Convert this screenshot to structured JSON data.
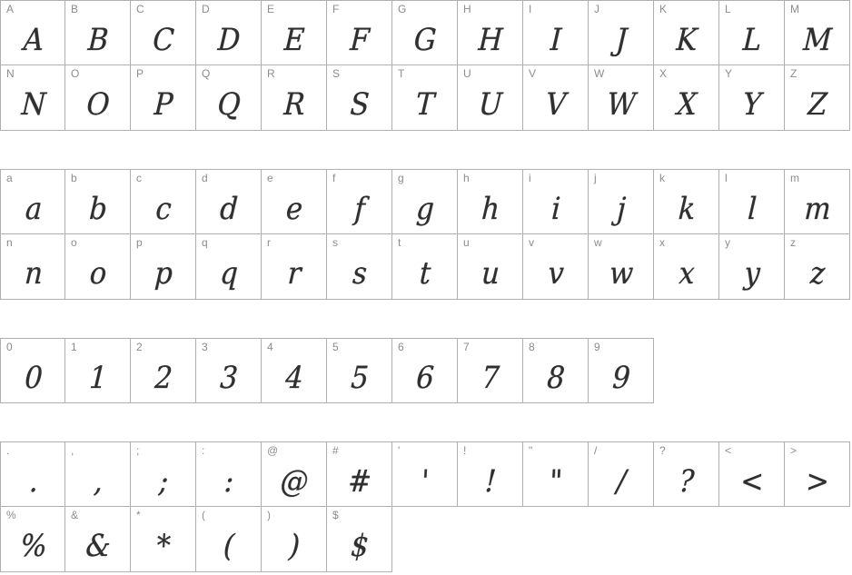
{
  "sheet": {
    "title": "Font specimen sheet",
    "colors": {
      "background": "#ffffff",
      "cell_border": "#b0b0b0",
      "label_text": "#8c8c8c",
      "glyph_text": "#2f2f2f"
    }
  },
  "sections": [
    {
      "id": "uppercase",
      "name": "uppercase-letters",
      "columns": 13,
      "rows": [
        [
          {
            "label": "A",
            "glyph": "A"
          },
          {
            "label": "B",
            "glyph": "B"
          },
          {
            "label": "C",
            "glyph": "C"
          },
          {
            "label": "D",
            "glyph": "D"
          },
          {
            "label": "E",
            "glyph": "E"
          },
          {
            "label": "F",
            "glyph": "F"
          },
          {
            "label": "G",
            "glyph": "G"
          },
          {
            "label": "H",
            "glyph": "H"
          },
          {
            "label": "I",
            "glyph": "I"
          },
          {
            "label": "J",
            "glyph": "J"
          },
          {
            "label": "K",
            "glyph": "K"
          },
          {
            "label": "L",
            "glyph": "L"
          },
          {
            "label": "M",
            "glyph": "M"
          }
        ],
        [
          {
            "label": "N",
            "glyph": "N"
          },
          {
            "label": "O",
            "glyph": "O"
          },
          {
            "label": "P",
            "glyph": "P"
          },
          {
            "label": "Q",
            "glyph": "Q"
          },
          {
            "label": "R",
            "glyph": "R"
          },
          {
            "label": "S",
            "glyph": "S"
          },
          {
            "label": "T",
            "glyph": "T"
          },
          {
            "label": "U",
            "glyph": "U"
          },
          {
            "label": "V",
            "glyph": "V"
          },
          {
            "label": "W",
            "glyph": "W"
          },
          {
            "label": "X",
            "glyph": "X"
          },
          {
            "label": "Y",
            "glyph": "Y"
          },
          {
            "label": "Z",
            "glyph": "Z"
          }
        ]
      ]
    },
    {
      "id": "lowercase",
      "name": "lowercase-letters",
      "columns": 13,
      "rows": [
        [
          {
            "label": "a",
            "glyph": "a"
          },
          {
            "label": "b",
            "glyph": "b"
          },
          {
            "label": "c",
            "glyph": "c"
          },
          {
            "label": "d",
            "glyph": "d"
          },
          {
            "label": "e",
            "glyph": "e"
          },
          {
            "label": "f",
            "glyph": "f"
          },
          {
            "label": "g",
            "glyph": "g"
          },
          {
            "label": "h",
            "glyph": "h"
          },
          {
            "label": "i",
            "glyph": "i"
          },
          {
            "label": "j",
            "glyph": "j"
          },
          {
            "label": "k",
            "glyph": "k"
          },
          {
            "label": "l",
            "glyph": "l"
          },
          {
            "label": "m",
            "glyph": "m"
          }
        ],
        [
          {
            "label": "n",
            "glyph": "n"
          },
          {
            "label": "o",
            "glyph": "o"
          },
          {
            "label": "p",
            "glyph": "p"
          },
          {
            "label": "q",
            "glyph": "q"
          },
          {
            "label": "r",
            "glyph": "r"
          },
          {
            "label": "s",
            "glyph": "s"
          },
          {
            "label": "t",
            "glyph": "t"
          },
          {
            "label": "u",
            "glyph": "u"
          },
          {
            "label": "v",
            "glyph": "v"
          },
          {
            "label": "w",
            "glyph": "w"
          },
          {
            "label": "x",
            "glyph": "x"
          },
          {
            "label": "y",
            "glyph": "y"
          },
          {
            "label": "z",
            "glyph": "z"
          }
        ]
      ]
    },
    {
      "id": "digits",
      "name": "numerals",
      "columns": 10,
      "rows": [
        [
          {
            "label": "0",
            "glyph": "0"
          },
          {
            "label": "1",
            "glyph": "1"
          },
          {
            "label": "2",
            "glyph": "2"
          },
          {
            "label": "3",
            "glyph": "3"
          },
          {
            "label": "4",
            "glyph": "4"
          },
          {
            "label": "5",
            "glyph": "5"
          },
          {
            "label": "6",
            "glyph": "6"
          },
          {
            "label": "7",
            "glyph": "7"
          },
          {
            "label": "8",
            "glyph": "8"
          },
          {
            "label": "9",
            "glyph": "9"
          }
        ]
      ]
    },
    {
      "id": "punctuation",
      "name": "punctuation-and-symbols",
      "columns": 13,
      "rows": [
        [
          {
            "label": ".",
            "glyph": "."
          },
          {
            "label": ",",
            "glyph": ","
          },
          {
            "label": ";",
            "glyph": ";"
          },
          {
            "label": ":",
            "glyph": ":"
          },
          {
            "label": "@",
            "glyph": "@"
          },
          {
            "label": "#",
            "glyph": "#"
          },
          {
            "label": "'",
            "glyph": "'"
          },
          {
            "label": "!",
            "glyph": "!"
          },
          {
            "label": "\"",
            "glyph": "\""
          },
          {
            "label": "/",
            "glyph": "/"
          },
          {
            "label": "?",
            "glyph": "?"
          },
          {
            "label": "<",
            "glyph": "<"
          },
          {
            "label": ">",
            "glyph": ">"
          }
        ],
        [
          {
            "label": "%",
            "glyph": "%"
          },
          {
            "label": "&",
            "glyph": "&"
          },
          {
            "label": "*",
            "glyph": "*"
          },
          {
            "label": "(",
            "glyph": "("
          },
          {
            "label": ")",
            "glyph": ")"
          },
          {
            "label": "$",
            "glyph": "$"
          }
        ]
      ]
    }
  ]
}
